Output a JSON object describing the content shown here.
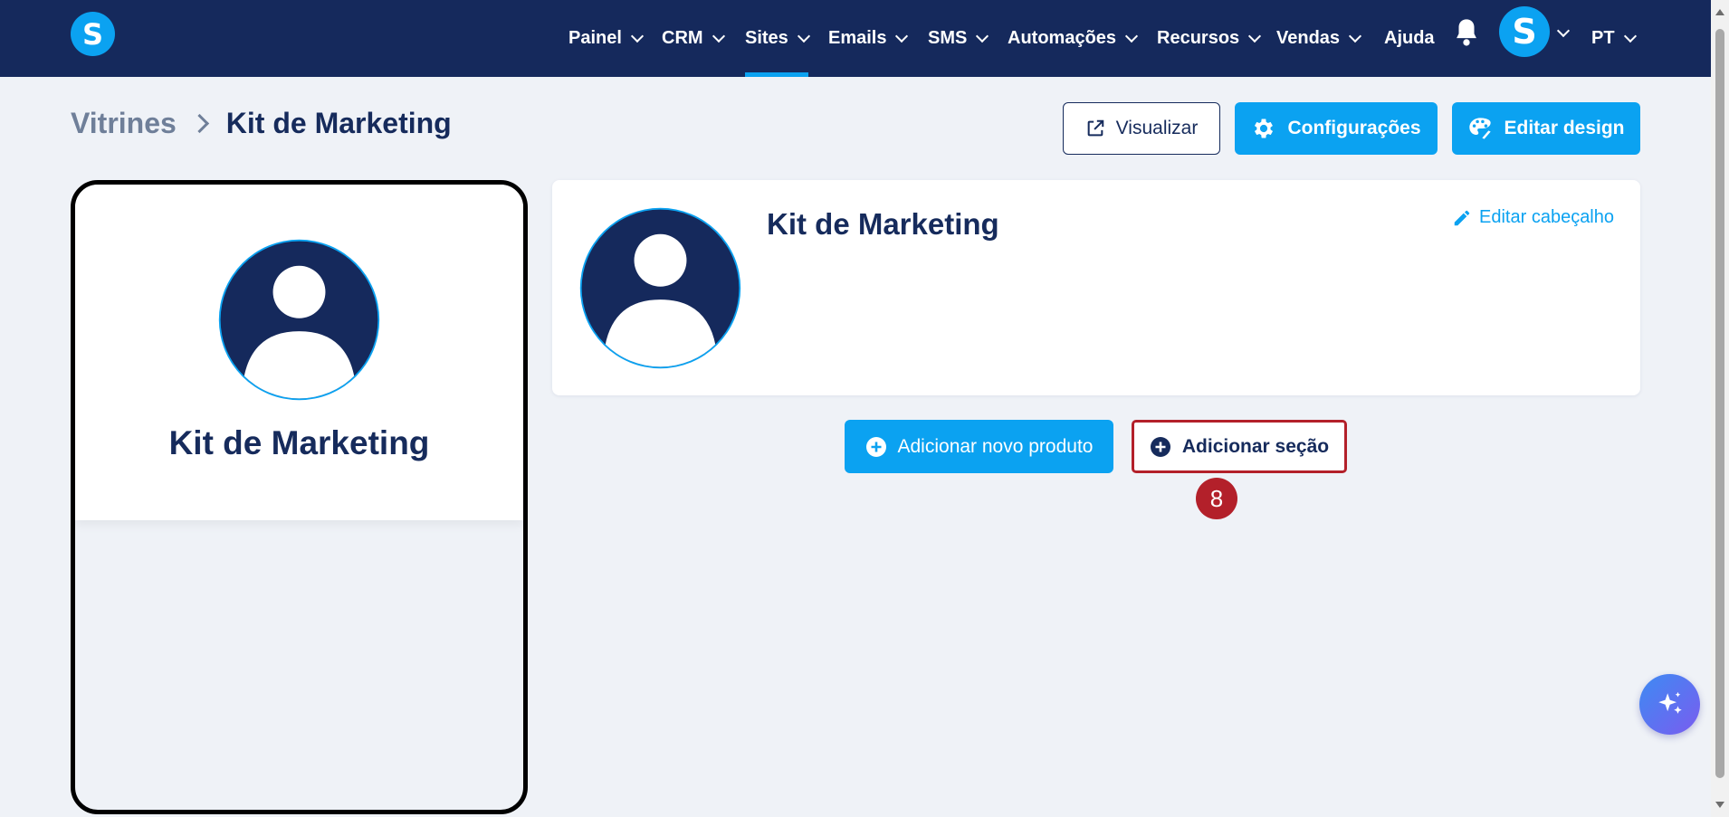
{
  "brand": {
    "logo_letter": "S"
  },
  "nav": {
    "items": [
      {
        "label": "Painel"
      },
      {
        "label": "CRM"
      },
      {
        "label": "Sites"
      },
      {
        "label": "Emails"
      },
      {
        "label": "SMS"
      },
      {
        "label": "Automações"
      },
      {
        "label": "Recursos"
      },
      {
        "label": "Vendas"
      },
      {
        "label": "Ajuda"
      }
    ],
    "active": "Sites",
    "user_initial": "S",
    "language": "PT"
  },
  "breadcrumb": {
    "parent": "Vitrines",
    "current": "Kit de Marketing"
  },
  "toolbar": {
    "preview_label": "Visualizar",
    "settings_label": "Configurações",
    "design_label": "Editar design"
  },
  "preview": {
    "title": "Kit de Marketing"
  },
  "header_card": {
    "title": "Kit de Marketing",
    "edit_label": "Editar cabeçalho"
  },
  "actions": {
    "add_product_label": "Adicionar novo produto",
    "add_section_label": "Adicionar seção"
  },
  "step_badge": "8",
  "colors": {
    "navy": "#15295c",
    "accent": "#0ba2f1",
    "highlight": "#b3202a",
    "background": "#eff2f7"
  },
  "icons": [
    "external-link-icon",
    "gear-icon",
    "palette-icon",
    "pencil-icon",
    "plus-circle-icon",
    "bell-icon",
    "sparkle-icon",
    "user-avatar-icon"
  ]
}
